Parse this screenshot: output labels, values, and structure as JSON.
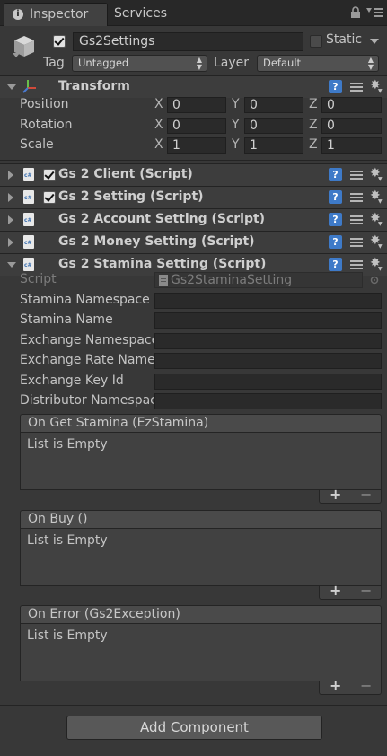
{
  "tabs": {
    "inspector": "Inspector",
    "services": "Services"
  },
  "object": {
    "name": "Gs2Settings",
    "active": true,
    "static_label": "Static",
    "static": false,
    "tag_label": "Tag",
    "tag_value": "Untagged",
    "layer_label": "Layer",
    "layer_value": "Default"
  },
  "transform": {
    "title": "Transform",
    "rows": [
      {
        "label": "Position",
        "x": "0",
        "y": "0",
        "z": "0"
      },
      {
        "label": "Rotation",
        "x": "0",
        "y": "0",
        "z": "0"
      },
      {
        "label": "Scale",
        "x": "1",
        "y": "1",
        "z": "1"
      }
    ],
    "axis": {
      "x": "X",
      "y": "Y",
      "z": "Z"
    }
  },
  "components": [
    {
      "title": "Gs 2 Client (Script)",
      "enabled": true
    },
    {
      "title": "Gs 2 Setting (Script)",
      "enabled": true
    },
    {
      "title": "Gs 2 Account Setting (Script)"
    },
    {
      "title": "Gs 2 Money Setting (Script)"
    },
    {
      "title": "Gs 2 Stamina Setting (Script)"
    }
  ],
  "stamina": {
    "script_label": "Script",
    "script_value": "Gs2StaminaSetting",
    "fields": [
      {
        "label": "Stamina Namespace N",
        "value": ""
      },
      {
        "label": "Stamina Name",
        "value": ""
      },
      {
        "label": "Exchange Namespace",
        "value": ""
      },
      {
        "label": "Exchange Rate Name",
        "value": ""
      },
      {
        "label": "Exchange Key Id",
        "value": ""
      },
      {
        "label": "Distributor Namespac",
        "value": ""
      }
    ],
    "events": [
      {
        "title": "On Get Stamina (EzStamina)",
        "empty": "List is Empty"
      },
      {
        "title": "On Buy ()",
        "empty": "List is Empty"
      },
      {
        "title": "On Error (Gs2Exception)",
        "empty": "List is Empty"
      }
    ],
    "plus": "+",
    "minus": "−"
  },
  "add_component": "Add Component",
  "colors": {
    "background": "#383838",
    "field": "#2a2a2a",
    "help": "#3e7ac8"
  }
}
